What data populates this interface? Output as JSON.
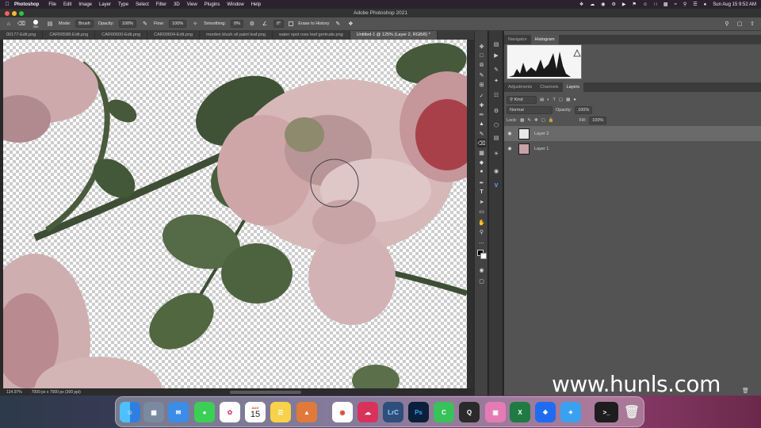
{
  "menubar": {
    "app": "Photoshop",
    "items": [
      "File",
      "Edit",
      "Image",
      "Layer",
      "Type",
      "Select",
      "Filter",
      "3D",
      "View",
      "Plugins",
      "Window",
      "Help"
    ],
    "clock": "Sun Aug 15  9:52 AM"
  },
  "window": {
    "title": "Adobe Photoshop 2021"
  },
  "options": {
    "brush_size": "300",
    "mode_label": "Mode:",
    "mode_value": "Brush",
    "opacity_label": "Opacity:",
    "opacity_value": "100%",
    "flow_label": "Flow:",
    "flow_value": "100%",
    "smoothing_label": "Smoothing:",
    "smoothing_value": "0%",
    "angle_value": "0°",
    "erase_history_label": "Erase to History"
  },
  "tabs": [
    {
      "label": "00177-Edit.png"
    },
    {
      "label": "CAR00588-Edit.png"
    },
    {
      "label": "CAR00600-Edit.png"
    },
    {
      "label": "CAR00604-Edit.png"
    },
    {
      "label": "morden blush oil paint leaf.png"
    },
    {
      "label": "water spot rose leaf gertrude.png"
    },
    {
      "label": "Untitled-1 @ 125% (Layer 2, RGB/8) *"
    }
  ],
  "status": {
    "zoom": "124.97%",
    "doc_size": "7000 px x 7000 px (300 ppi)"
  },
  "panels": {
    "top_tabs": [
      "Navigator",
      "Histogram"
    ],
    "top_active": "Histogram",
    "layer_tabs": [
      "Adjustments",
      "Channels",
      "Layers"
    ],
    "layer_active": "Layers",
    "kind_label": "Kind",
    "blend_mode": "Normal",
    "opacity_label": "Opacity:",
    "opacity_value": "100%",
    "lock_label": "Lock:",
    "fill_label": "Fill:",
    "fill_value": "100%",
    "layers": [
      {
        "name": "Layer 2",
        "selected": true
      },
      {
        "name": "Layer 1",
        "selected": false
      }
    ]
  },
  "watermark": "www.hunls.com",
  "dock": {
    "calendar_month": "AUG",
    "calendar_day": "15",
    "apps": [
      "finder-icon",
      "launchpad-icon",
      "mail-icon",
      "messages-icon",
      "photos-icon",
      "calendar-icon",
      "notes-icon",
      "app-icon",
      "chrome-icon",
      "creative-cloud-icon",
      "lightroom-classic-icon",
      "photoshop-icon",
      "facetime-icon",
      "quicktime-icon",
      "screen-icon",
      "excel-icon",
      "dropbox-icon",
      "safari-icon",
      "terminal-icon",
      "trash-icon"
    ]
  },
  "colors": {
    "ps_blue": "#31a8ff",
    "lrc_blue": "#2d4f7a",
    "panel_gray": "#535353"
  }
}
